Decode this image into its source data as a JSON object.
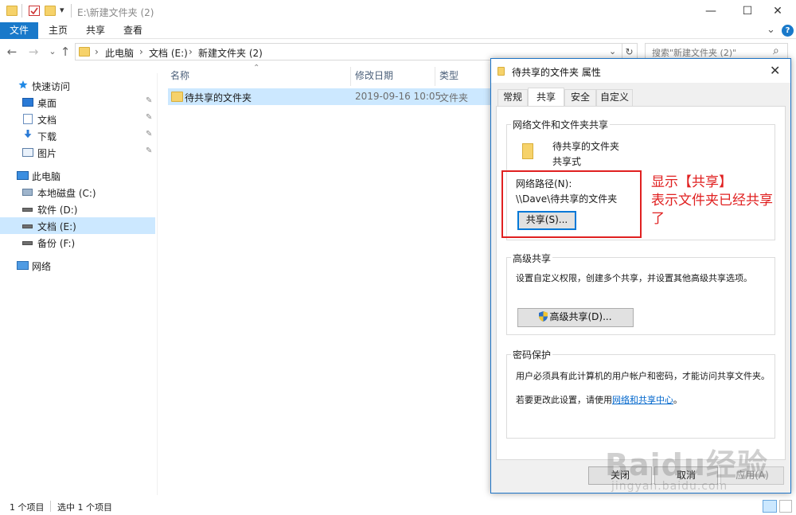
{
  "window": {
    "title": "E:\\新建文件夹 (2)",
    "qat_dropdown": "▾",
    "minimize": "—",
    "maximize": "☐",
    "close": "✕"
  },
  "ribbon": {
    "tabs": [
      "文件",
      "主页",
      "共享",
      "查看"
    ],
    "collapse": "⌄",
    "help": "?"
  },
  "navbar": {
    "back": "←",
    "forward": "→",
    "recent": "⌄",
    "up": "↑",
    "breadcrumb": [
      "此电脑",
      "文档 (E:)",
      "新建文件夹 (2)"
    ],
    "separator": "›",
    "address_dropdown": "⌄",
    "refresh": "↻",
    "search_placeholder": "搜索\"新建文件夹 (2)\"",
    "search_icon": "⌕"
  },
  "nav_pane": {
    "items": [
      {
        "label": "快速访问",
        "icon": "star-icon"
      },
      {
        "label": "桌面",
        "icon": "desktop-icon",
        "pinned": true
      },
      {
        "label": "文档",
        "icon": "document-icon",
        "pinned": true
      },
      {
        "label": "下载",
        "icon": "download-icon",
        "pinned": true
      },
      {
        "label": "图片",
        "icon": "picture-icon",
        "pinned": true
      },
      {
        "label": "此电脑",
        "icon": "computer-icon"
      },
      {
        "label": "本地磁盘 (C:)",
        "icon": "windows-drive-icon"
      },
      {
        "label": "软件 (D:)",
        "icon": "drive-icon"
      },
      {
        "label": "文档 (E:)",
        "icon": "drive-icon",
        "selected": true
      },
      {
        "label": "备份 (F:)",
        "icon": "drive-icon"
      },
      {
        "label": "网络",
        "icon": "network-icon"
      }
    ],
    "pin_glyph": "📌"
  },
  "file_list": {
    "sort_arrow": "⌃",
    "columns": [
      "名称",
      "修改日期",
      "类型"
    ],
    "rows": [
      {
        "name": "待共享的文件夹",
        "modified": "2019-09-16 10:05",
        "type": "文件夹",
        "selected": true
      }
    ]
  },
  "status_bar": {
    "item_count": "1 个项目",
    "selected_count": "选中 1 个项目"
  },
  "dialog": {
    "title": "待共享的文件夹 属性",
    "close": "✕",
    "tabs": [
      "常规",
      "共享",
      "安全",
      "自定义"
    ],
    "active_tab": "共享",
    "network_sharing": {
      "heading": "网络文件和文件夹共享",
      "folder_name": "待共享的文件夹",
      "share_state": "共享式",
      "path_label": "网络路径(N):",
      "path_value": "\\\\Dave\\待共享的文件夹",
      "share_button": "共享(S)..."
    },
    "advanced_sharing": {
      "heading": "高级共享",
      "description": "设置自定义权限，创建多个共享，并设置其他高级共享选项。",
      "button": "高级共享(D)..."
    },
    "password_protection": {
      "heading": "密码保护",
      "description": "用户必须具有此计算机的用户帐户和密码，才能访问共享文件夹。",
      "change_prefix": "若要更改此设置，请使用",
      "link": "网络和共享中心",
      "change_suffix": "。"
    },
    "footer": {
      "close": "关闭",
      "cancel": "取消",
      "apply": "应用(A)"
    }
  },
  "annotation": {
    "line1": "显示【共享】",
    "line2": "表示文件夹已经共享",
    "line3": "了",
    "color": "#e02020"
  },
  "watermark": {
    "brand": "Baidu经验",
    "url": "jingyan.baidu.com"
  },
  "colors": {
    "accent": "#1979ca",
    "selection": "#cce8ff",
    "dialog_border": "#1e74c6",
    "folder": "#f6d26a"
  }
}
